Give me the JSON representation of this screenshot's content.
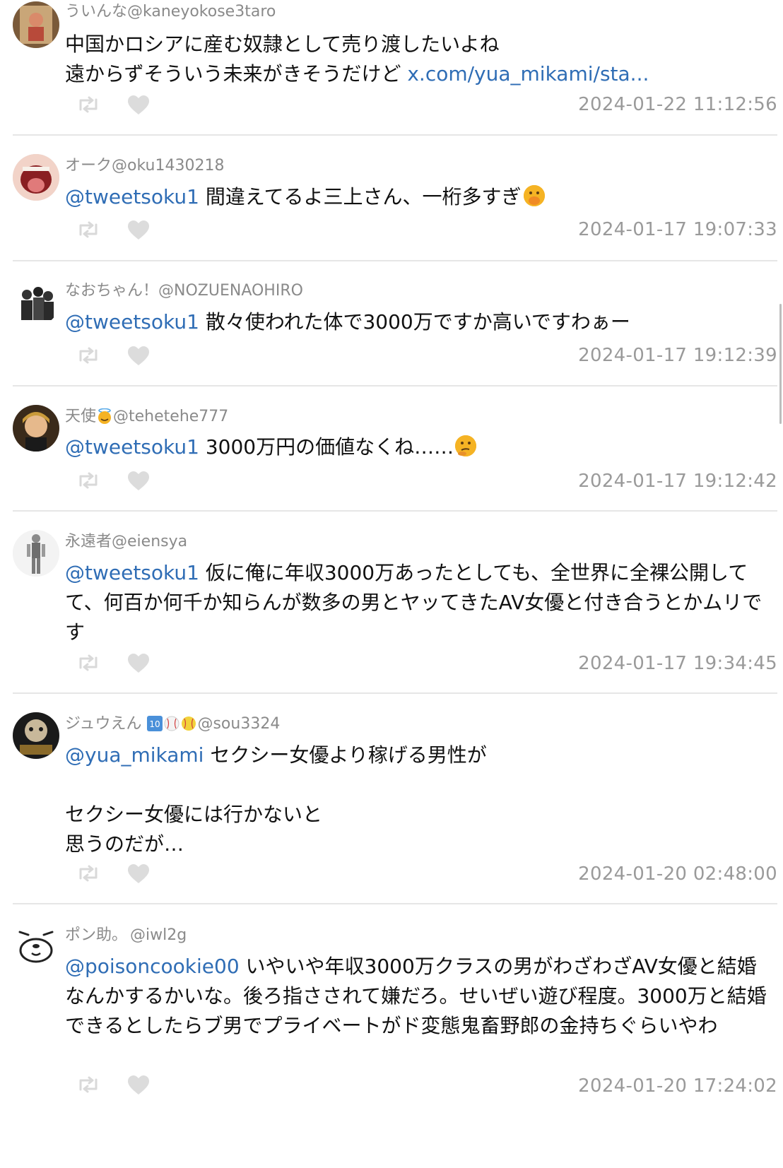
{
  "tweets": [
    {
      "display_name": "ういんな",
      "handle": "@kaneyokose3taro",
      "mention": "",
      "text": "中国かロシアに産む奴隷として売り渡したいよね\n遠からずそういう未来がきそうだけど ",
      "link": "x.com/yua_mikami/sta...",
      "timestamp": "2024-01-22 11:12:56"
    },
    {
      "display_name": "オーク",
      "handle": "@oku1430218",
      "mention": "@tweetsoku1",
      "text": " 間違えてるよ三上さん、一桁多すぎ",
      "trailing_emoji": "face-with-hand-over-mouth-emoji",
      "timestamp": "2024-01-17 19:07:33"
    },
    {
      "display_name": "なおちゃん！",
      "handle": "@NOZUENAOHIRO",
      "mention": "@tweetsoku1",
      "text": " 散々使われた体で3000万ですか高いですわぁー",
      "timestamp": "2024-01-17 19:12:39"
    },
    {
      "display_name": "天使",
      "name_emoji": "smiling-face-with-halo-emoji",
      "handle": "@tehetehe777",
      "mention": "@tweetsoku1",
      "text": " 3000万円の価値なくね……",
      "trailing_emoji": "thinking-face-emoji",
      "timestamp": "2024-01-17 19:12:42"
    },
    {
      "display_name": "永遠者",
      "handle": "@eiensya",
      "mention": "@tweetsoku1",
      "text": " 仮に俺に年収3000万あったとしても、全世界に全裸公開してて、何百か何千か知らんが数多の男とヤッてきたAV女優と付き合うとかムリです",
      "timestamp": "2024-01-17 19:34:45"
    },
    {
      "display_name": "ジュウえん",
      "name_emoji": "keycap-ten-baseball-softball-emoji",
      "handle": "@sou3324",
      "mention": "@yua_mikami",
      "text": " セクシー女優より稼げる男性が\n\nセクシー女優には行かないと\n思うのだが…",
      "timestamp": "2024-01-20 02:48:00"
    },
    {
      "display_name": "ポン助。",
      "handle": "@iwl2g",
      "mention": "@poisoncookie00",
      "text": " いやいや年収3000万クラスの男がわざわざAV女優と結婚なんかするかいな。後ろ指さされて嫌だろ。せいぜい遊び程度。3000万と結婚できるとしたらブ男でプライベートがド変態鬼畜野郎の金持ちぐらいやわ",
      "timestamp": "2024-01-20 17:24:02"
    }
  ],
  "icons": {
    "retweet": "retweet-icon",
    "like": "heart-icon"
  },
  "colors": {
    "mention": "#2f6db5",
    "meta": "#8a8a8a",
    "timestamp": "#9a9a9a",
    "divider": "#e6e6e6",
    "action_icon": "#d9d9d9"
  }
}
